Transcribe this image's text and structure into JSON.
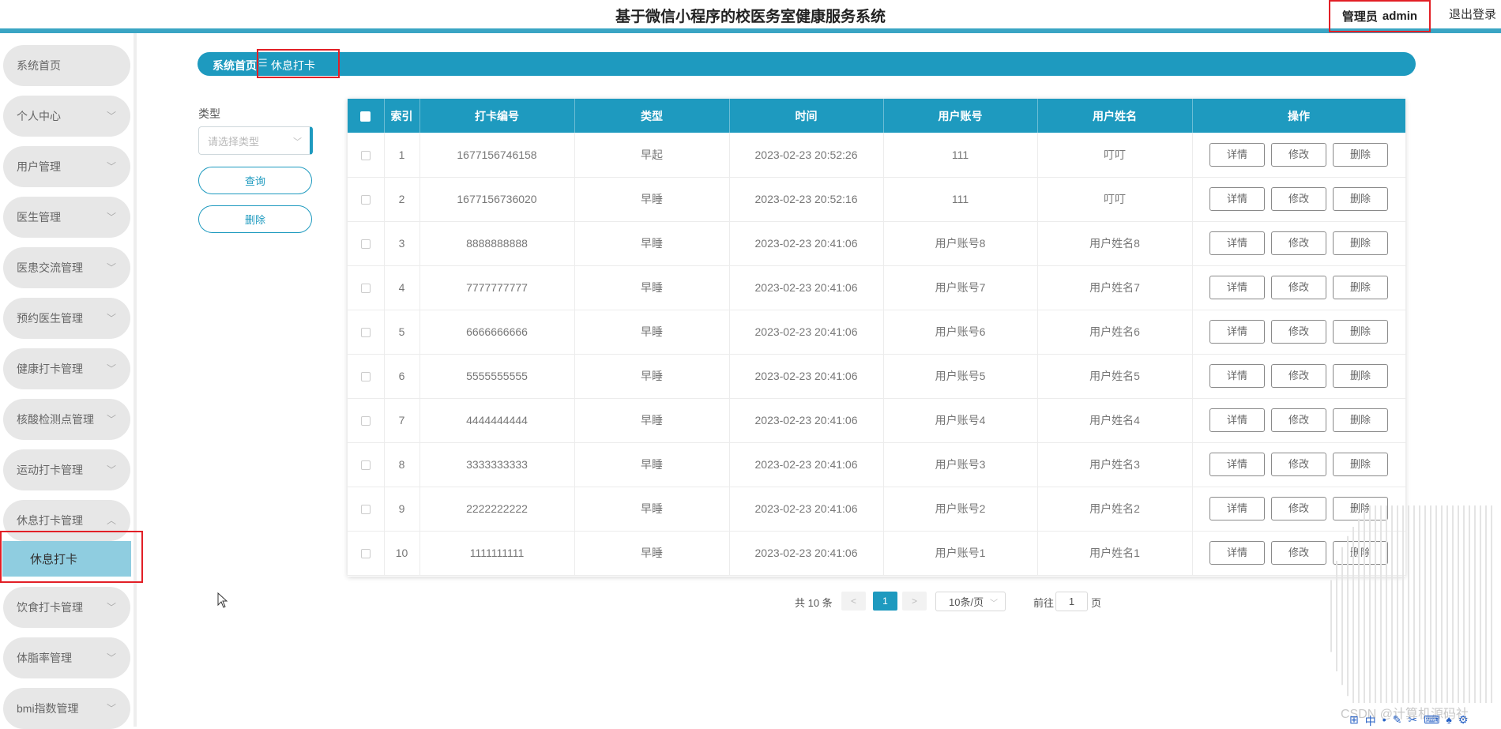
{
  "app": {
    "title": "基于微信小程序的校医务室健康服务系统"
  },
  "header": {
    "role": "管理员",
    "username": "admin",
    "logout": "退出登录"
  },
  "sidebar": {
    "items": [
      {
        "label": "系统首页",
        "chevron": false
      },
      {
        "label": "个人中心",
        "chevron": true
      },
      {
        "label": "用户管理",
        "chevron": true
      },
      {
        "label": "医生管理",
        "chevron": true
      },
      {
        "label": "医患交流管理",
        "chevron": true
      },
      {
        "label": "预约医生管理",
        "chevron": true
      },
      {
        "label": "健康打卡管理",
        "chevron": true
      },
      {
        "label": "核酸检测点管理",
        "chevron": true
      },
      {
        "label": "运动打卡管理",
        "chevron": true
      },
      {
        "label": "休息打卡管理",
        "chevron": true,
        "expanded": true
      },
      {
        "label": "饮食打卡管理",
        "chevron": true
      },
      {
        "label": "体脂率管理",
        "chevron": true
      },
      {
        "label": "bmi指数管理",
        "chevron": true
      }
    ],
    "active_sub": "休息打卡"
  },
  "breadcrumb": {
    "home": "系统首页",
    "current": "休息打卡"
  },
  "filter": {
    "label": "类型",
    "placeholder": "请选择类型",
    "query_button": "查询",
    "delete_button": "删除"
  },
  "table": {
    "columns": [
      "索引",
      "打卡编号",
      "类型",
      "时间",
      "用户账号",
      "用户姓名",
      "操作"
    ],
    "actions": {
      "detail": "详情",
      "edit": "修改",
      "delete": "删除"
    },
    "rows": [
      {
        "index": "1",
        "code": "1677156746158",
        "type": "早起",
        "time": "2023-02-23 20:52:26",
        "account": "111",
        "name": "叮叮"
      },
      {
        "index": "2",
        "code": "1677156736020",
        "type": "早睡",
        "time": "2023-02-23 20:52:16",
        "account": "111",
        "name": "叮叮"
      },
      {
        "index": "3",
        "code": "8888888888",
        "type": "早睡",
        "time": "2023-02-23 20:41:06",
        "account": "用户账号8",
        "name": "用户姓名8"
      },
      {
        "index": "4",
        "code": "7777777777",
        "type": "早睡",
        "time": "2023-02-23 20:41:06",
        "account": "用户账号7",
        "name": "用户姓名7"
      },
      {
        "index": "5",
        "code": "6666666666",
        "type": "早睡",
        "time": "2023-02-23 20:41:06",
        "account": "用户账号6",
        "name": "用户姓名6"
      },
      {
        "index": "6",
        "code": "5555555555",
        "type": "早睡",
        "time": "2023-02-23 20:41:06",
        "account": "用户账号5",
        "name": "用户姓名5"
      },
      {
        "index": "7",
        "code": "4444444444",
        "type": "早睡",
        "time": "2023-02-23 20:41:06",
        "account": "用户账号4",
        "name": "用户姓名4"
      },
      {
        "index": "8",
        "code": "3333333333",
        "type": "早睡",
        "time": "2023-02-23 20:41:06",
        "account": "用户账号3",
        "name": "用户姓名3"
      },
      {
        "index": "9",
        "code": "2222222222",
        "type": "早睡",
        "time": "2023-02-23 20:41:06",
        "account": "用户账号2",
        "name": "用户姓名2"
      },
      {
        "index": "10",
        "code": "1111111111",
        "type": "早睡",
        "time": "2023-02-23 20:41:06",
        "account": "用户账号1",
        "name": "用户姓名1"
      }
    ]
  },
  "pagination": {
    "total_text": "共 10 条",
    "prev": "<",
    "current_page": "1",
    "next": ">",
    "page_size": "10条/页",
    "goto_label": "前往",
    "goto_value": "1",
    "page_suffix": "页"
  },
  "watermark": "CSDN @计算机源码社",
  "colors": {
    "primary": "#1e9abf",
    "header_bar": "#3aa5c4",
    "sub_active": "#8fcde0",
    "highlight_frame": "#e21f26"
  }
}
